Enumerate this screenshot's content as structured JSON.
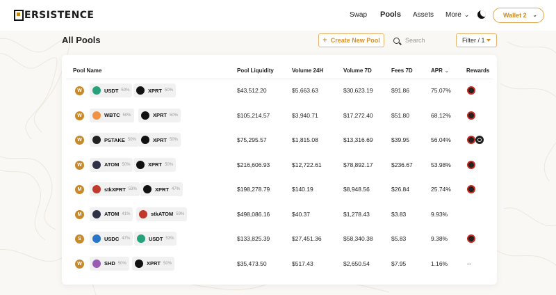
{
  "brand": {
    "logo_text": "ERSISTENCE"
  },
  "nav": {
    "items": [
      {
        "label": "Swap",
        "active": false
      },
      {
        "label": "Pools",
        "active": true
      },
      {
        "label": "Assets",
        "active": false
      },
      {
        "label": "More",
        "active": false
      }
    ],
    "theme_icon": "moon-icon",
    "wallet_label": "Wallet 2"
  },
  "page": {
    "title": "All Pools",
    "create_label": "Create New Pool",
    "search_placeholder": "Search",
    "filter_label": "Filter / 1"
  },
  "table": {
    "headers": {
      "pool_name": "Pool Name",
      "liquidity": "Pool Liquidity",
      "volume_24h": "Volume 24H",
      "volume_7d": "Volume 7D",
      "fees_7d": "Fees 7D",
      "apr": "APR",
      "rewards": "Rewards"
    },
    "rows": [
      {
        "icon": "W",
        "t1": {
          "sym": "USDT",
          "pct": "50%",
          "color": "#26a17b",
          "icon": "tether-icon"
        },
        "t2": {
          "sym": "XPRT",
          "pct": "50%",
          "color": "#111111",
          "icon": "persistence-icon"
        },
        "liquidity": "$43,512.20",
        "vol24": "$5,663.63",
        "vol7": "$30,623.19",
        "fees7": "$91.86",
        "apr": "75.07%",
        "rewards": [
          "xprt"
        ]
      },
      {
        "icon": "W",
        "t1": {
          "sym": "WBTC",
          "pct": "50%",
          "color": "#f09242",
          "icon": "wbtc-icon"
        },
        "t2": {
          "sym": "XPRT",
          "pct": "50%",
          "color": "#111111",
          "icon": "persistence-icon"
        },
        "liquidity": "$105,214.57",
        "vol24": "$3,940.71",
        "vol7": "$17,272.40",
        "fees7": "$51.80",
        "apr": "68.12%",
        "rewards": [
          "xprt"
        ]
      },
      {
        "icon": "W",
        "t1": {
          "sym": "PSTAKE",
          "pct": "50%",
          "color": "#222222",
          "icon": "pstake-icon"
        },
        "t2": {
          "sym": "XPRT",
          "pct": "50%",
          "color": "#111111",
          "icon": "persistence-icon"
        },
        "liquidity": "$75,295.57",
        "vol24": "$1,815.08",
        "vol7": "$13,316.69",
        "fees7": "$39.95",
        "apr": "56.04%",
        "rewards": [
          "xprt",
          "pstake"
        ]
      },
      {
        "icon": "W",
        "t1": {
          "sym": "ATOM",
          "pct": "50%",
          "color": "#2e3148",
          "icon": "atom-icon"
        },
        "t2": {
          "sym": "XPRT",
          "pct": "50%",
          "color": "#111111",
          "icon": "persistence-icon"
        },
        "liquidity": "$216,606.93",
        "vol24": "$12,722.61",
        "vol7": "$78,892.17",
        "fees7": "$236.67",
        "apr": "53.98%",
        "rewards": [
          "xprt"
        ]
      },
      {
        "icon": "M",
        "t1": {
          "sym": "stkXPRT",
          "pct": "53%",
          "color": "#c0392b",
          "icon": "stkxprt-icon"
        },
        "t2": {
          "sym": "XPRT",
          "pct": "47%",
          "color": "#111111",
          "icon": "persistence-icon"
        },
        "liquidity": "$198,278.79",
        "vol24": "$140.19",
        "vol7": "$8,948.56",
        "fees7": "$26.84",
        "apr": "25.74%",
        "rewards": [
          "xprt"
        ]
      },
      {
        "icon": "M",
        "t1": {
          "sym": "ATOM",
          "pct": "41%",
          "color": "#2e3148",
          "icon": "atom-icon"
        },
        "t2": {
          "sym": "stkATOM",
          "pct": "59%",
          "color": "#c0392b",
          "icon": "stkatom-icon"
        },
        "liquidity": "$498,086.16",
        "vol24": "$40.37",
        "vol7": "$1,278.43",
        "fees7": "$3.83",
        "apr": "9.93%",
        "rewards": []
      },
      {
        "icon": "S",
        "t1": {
          "sym": "USDC",
          "pct": "47%",
          "color": "#2775ca",
          "icon": "usdc-icon"
        },
        "t2": {
          "sym": "USDT",
          "pct": "53%",
          "color": "#26a17b",
          "icon": "tether-icon"
        },
        "liquidity": "$133,825.39",
        "vol24": "$27,451.36",
        "vol7": "$58,340.38",
        "fees7": "$5.83",
        "apr": "9.38%",
        "rewards": [
          "xprt"
        ]
      },
      {
        "icon": "W",
        "t1": {
          "sym": "SHD",
          "pct": "50%",
          "color": "#9b59b6",
          "icon": "shade-icon"
        },
        "t2": {
          "sym": "XPRT",
          "pct": "50%",
          "color": "#111111",
          "icon": "persistence-icon"
        },
        "liquidity": "$35,473.50",
        "vol24": "$517.43",
        "vol7": "$2,650.54",
        "fees7": "$7.95",
        "apr": "1.16%",
        "rewards": [],
        "rewards_empty": "--"
      }
    ]
  },
  "colors": {
    "accent": "#d9912a",
    "reward_ring": "#c8281e"
  }
}
